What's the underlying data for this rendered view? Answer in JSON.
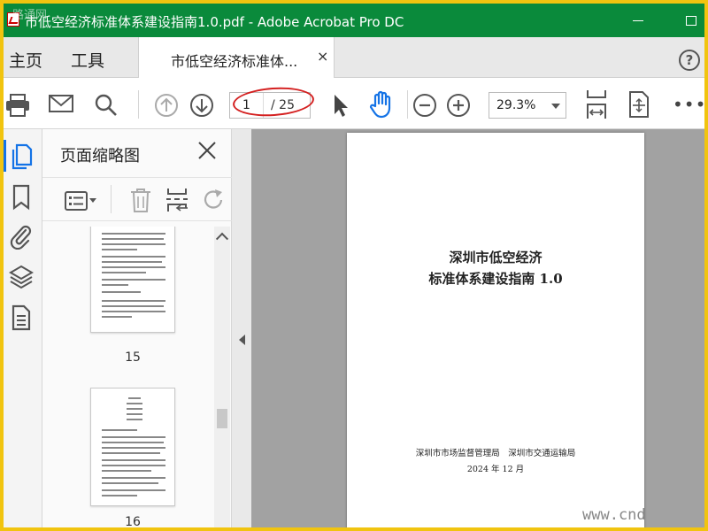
{
  "window": {
    "title": "市低空经济标准体系建设指南1.0.pdf - Adobe Acrobat Pro DC",
    "watermark": "路通网"
  },
  "menu": {
    "home": "主页",
    "tools": "工具",
    "tab_label": "市低空经济标准体...",
    "tab_close": "×",
    "help": "?"
  },
  "toolbar": {
    "current_page": "1",
    "total_pages": "/ 25",
    "zoom": "29.3%",
    "more": "•••"
  },
  "panel": {
    "title": "页面缩略图",
    "thumbnails": [
      {
        "label": "15"
      },
      {
        "label": "16"
      }
    ]
  },
  "document": {
    "title_line1": "深圳市低空经济",
    "title_line2": "标准体系建设指南 1.0",
    "issuers": "深圳市市场监督管理局　深圳市交通运输局",
    "date": "2024 年 12 月"
  },
  "site_watermark": "www.cnd",
  "colors": {
    "titlebar": "#0a8a3b",
    "frame_border": "#f1c40f",
    "highlight_oval": "#d42020",
    "accent": "#1473e6"
  },
  "icons": [
    "pdf-icon",
    "minimize-icon",
    "maximize-icon",
    "help-icon",
    "print-icon",
    "email-icon",
    "search-icon",
    "page-up-icon",
    "page-down-icon",
    "select-cursor-icon",
    "hand-icon",
    "zoom-out-icon",
    "zoom-in-icon",
    "fit-width-icon",
    "page-fit-icon",
    "more-icon",
    "thumbnails-icon",
    "bookmark-icon",
    "attachment-icon",
    "layers-icon",
    "page-content-icon",
    "close-icon",
    "options-icon",
    "trash-icon",
    "page-break-icon",
    "rotate-icon"
  ]
}
